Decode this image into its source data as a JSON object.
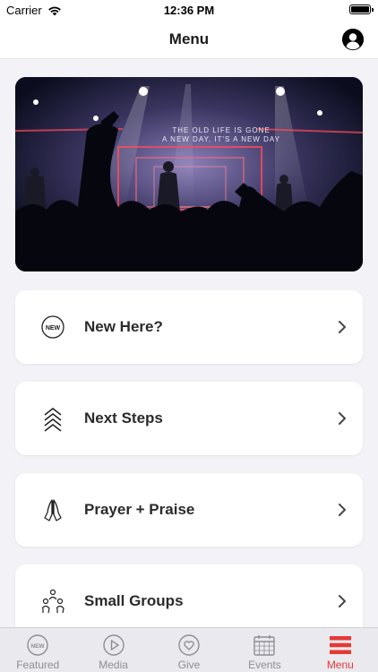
{
  "status_bar": {
    "carrier": "Carrier",
    "time": "12:36 PM"
  },
  "nav": {
    "title": "Menu"
  },
  "menu_items": [
    {
      "label": "New Here?",
      "icon": "new-badge-icon"
    },
    {
      "label": "Next Steps",
      "icon": "chevrons-up-icon"
    },
    {
      "label": "Prayer + Praise",
      "icon": "praying-hands-icon"
    },
    {
      "label": "Small Groups",
      "icon": "people-group-icon"
    }
  ],
  "hero": {
    "text": "THE OLD LIFE IS GONE A NEW DAY, IT'S A NEW DAY"
  },
  "tabs": [
    {
      "label": "Featured",
      "icon": "new-badge-icon"
    },
    {
      "label": "Media",
      "icon": "play-circle-icon"
    },
    {
      "label": "Give",
      "icon": "heart-circle-icon"
    },
    {
      "label": "Events",
      "icon": "calendar-icon"
    },
    {
      "label": "Menu",
      "icon": "hamburger-menu-icon",
      "active": true
    }
  ],
  "colors": {
    "accent": "#e53935",
    "tab_inactive": "#8e8e93",
    "background": "#f2f2f7"
  }
}
